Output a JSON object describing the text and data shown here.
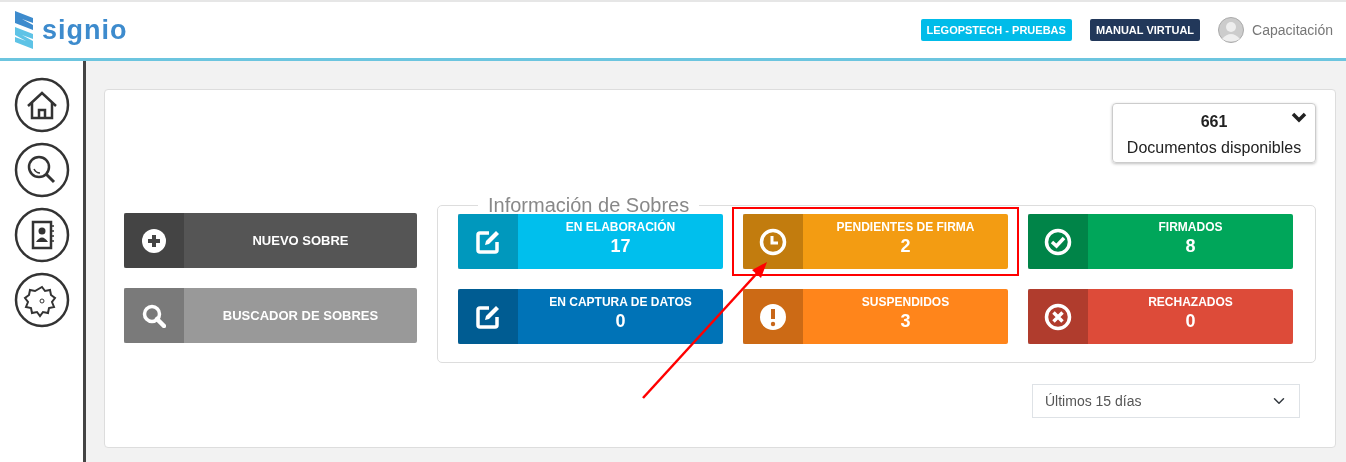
{
  "header": {
    "logo": "signio",
    "badges": [
      {
        "label": "LEGOPSTECH - PRUEBAS",
        "color": "#00bce9"
      },
      {
        "label": "MANUAL VIRTUAL",
        "color": "#22385a"
      }
    ],
    "user": "Capacitación"
  },
  "sidebar": {
    "items": [
      {
        "kind": "home"
      },
      {
        "kind": "search"
      },
      {
        "kind": "contacts"
      },
      {
        "kind": "settings"
      }
    ]
  },
  "documents": {
    "count": "661",
    "label": "Documentos disponibles"
  },
  "actions": [
    {
      "label": "NUEVO SOBRE",
      "kind": "new"
    },
    {
      "label": "BUSCADOR DE SOBRES",
      "kind": "search"
    }
  ],
  "envelope_info": {
    "title": "Información de Sobres",
    "tiles": [
      {
        "label": "EN ELABORACIÓN",
        "count": "17",
        "kind": "edit",
        "color": "#00bfed",
        "highlighted": false
      },
      {
        "label": "PENDIENTES DE FIRMA",
        "count": "2",
        "kind": "clock",
        "color": "#f39c12",
        "highlighted": true
      },
      {
        "label": "FIRMADOS",
        "count": "8",
        "kind": "check",
        "color": "#00a65a",
        "highlighted": false
      },
      {
        "label": "EN CAPTURA DE DATOS",
        "count": "0",
        "kind": "edit",
        "color": "#0073b7",
        "highlighted": false
      },
      {
        "label": "SUSPENDIDOS",
        "count": "3",
        "kind": "alert",
        "color": "#ff851b",
        "highlighted": false
      },
      {
        "label": "RECHAZADOS",
        "count": "0",
        "kind": "cross",
        "color": "#dd4b39",
        "highlighted": false
      }
    ]
  },
  "period": {
    "value": "Últimos 15 días"
  }
}
